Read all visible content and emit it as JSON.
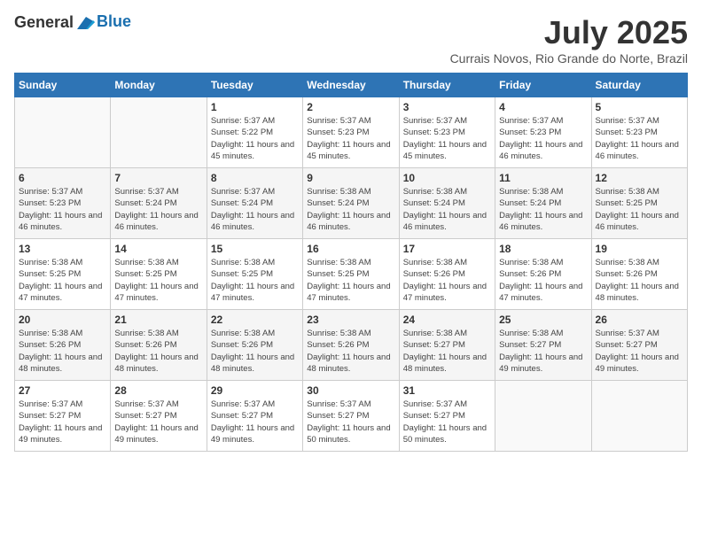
{
  "header": {
    "logo_line1": "General",
    "logo_line2": "Blue",
    "month_title": "July 2025",
    "location": "Currais Novos, Rio Grande do Norte, Brazil"
  },
  "days_of_week": [
    "Sunday",
    "Monday",
    "Tuesday",
    "Wednesday",
    "Thursday",
    "Friday",
    "Saturday"
  ],
  "weeks": [
    [
      {
        "day": "",
        "info": ""
      },
      {
        "day": "",
        "info": ""
      },
      {
        "day": "1",
        "info": "Sunrise: 5:37 AM\nSunset: 5:22 PM\nDaylight: 11 hours and 45 minutes."
      },
      {
        "day": "2",
        "info": "Sunrise: 5:37 AM\nSunset: 5:23 PM\nDaylight: 11 hours and 45 minutes."
      },
      {
        "day": "3",
        "info": "Sunrise: 5:37 AM\nSunset: 5:23 PM\nDaylight: 11 hours and 45 minutes."
      },
      {
        "day": "4",
        "info": "Sunrise: 5:37 AM\nSunset: 5:23 PM\nDaylight: 11 hours and 46 minutes."
      },
      {
        "day": "5",
        "info": "Sunrise: 5:37 AM\nSunset: 5:23 PM\nDaylight: 11 hours and 46 minutes."
      }
    ],
    [
      {
        "day": "6",
        "info": "Sunrise: 5:37 AM\nSunset: 5:23 PM\nDaylight: 11 hours and 46 minutes."
      },
      {
        "day": "7",
        "info": "Sunrise: 5:37 AM\nSunset: 5:24 PM\nDaylight: 11 hours and 46 minutes."
      },
      {
        "day": "8",
        "info": "Sunrise: 5:37 AM\nSunset: 5:24 PM\nDaylight: 11 hours and 46 minutes."
      },
      {
        "day": "9",
        "info": "Sunrise: 5:38 AM\nSunset: 5:24 PM\nDaylight: 11 hours and 46 minutes."
      },
      {
        "day": "10",
        "info": "Sunrise: 5:38 AM\nSunset: 5:24 PM\nDaylight: 11 hours and 46 minutes."
      },
      {
        "day": "11",
        "info": "Sunrise: 5:38 AM\nSunset: 5:24 PM\nDaylight: 11 hours and 46 minutes."
      },
      {
        "day": "12",
        "info": "Sunrise: 5:38 AM\nSunset: 5:25 PM\nDaylight: 11 hours and 46 minutes."
      }
    ],
    [
      {
        "day": "13",
        "info": "Sunrise: 5:38 AM\nSunset: 5:25 PM\nDaylight: 11 hours and 47 minutes."
      },
      {
        "day": "14",
        "info": "Sunrise: 5:38 AM\nSunset: 5:25 PM\nDaylight: 11 hours and 47 minutes."
      },
      {
        "day": "15",
        "info": "Sunrise: 5:38 AM\nSunset: 5:25 PM\nDaylight: 11 hours and 47 minutes."
      },
      {
        "day": "16",
        "info": "Sunrise: 5:38 AM\nSunset: 5:25 PM\nDaylight: 11 hours and 47 minutes."
      },
      {
        "day": "17",
        "info": "Sunrise: 5:38 AM\nSunset: 5:26 PM\nDaylight: 11 hours and 47 minutes."
      },
      {
        "day": "18",
        "info": "Sunrise: 5:38 AM\nSunset: 5:26 PM\nDaylight: 11 hours and 47 minutes."
      },
      {
        "day": "19",
        "info": "Sunrise: 5:38 AM\nSunset: 5:26 PM\nDaylight: 11 hours and 48 minutes."
      }
    ],
    [
      {
        "day": "20",
        "info": "Sunrise: 5:38 AM\nSunset: 5:26 PM\nDaylight: 11 hours and 48 minutes."
      },
      {
        "day": "21",
        "info": "Sunrise: 5:38 AM\nSunset: 5:26 PM\nDaylight: 11 hours and 48 minutes."
      },
      {
        "day": "22",
        "info": "Sunrise: 5:38 AM\nSunset: 5:26 PM\nDaylight: 11 hours and 48 minutes."
      },
      {
        "day": "23",
        "info": "Sunrise: 5:38 AM\nSunset: 5:26 PM\nDaylight: 11 hours and 48 minutes."
      },
      {
        "day": "24",
        "info": "Sunrise: 5:38 AM\nSunset: 5:27 PM\nDaylight: 11 hours and 48 minutes."
      },
      {
        "day": "25",
        "info": "Sunrise: 5:38 AM\nSunset: 5:27 PM\nDaylight: 11 hours and 49 minutes."
      },
      {
        "day": "26",
        "info": "Sunrise: 5:37 AM\nSunset: 5:27 PM\nDaylight: 11 hours and 49 minutes."
      }
    ],
    [
      {
        "day": "27",
        "info": "Sunrise: 5:37 AM\nSunset: 5:27 PM\nDaylight: 11 hours and 49 minutes."
      },
      {
        "day": "28",
        "info": "Sunrise: 5:37 AM\nSunset: 5:27 PM\nDaylight: 11 hours and 49 minutes."
      },
      {
        "day": "29",
        "info": "Sunrise: 5:37 AM\nSunset: 5:27 PM\nDaylight: 11 hours and 49 minutes."
      },
      {
        "day": "30",
        "info": "Sunrise: 5:37 AM\nSunset: 5:27 PM\nDaylight: 11 hours and 50 minutes."
      },
      {
        "day": "31",
        "info": "Sunrise: 5:37 AM\nSunset: 5:27 PM\nDaylight: 11 hours and 50 minutes."
      },
      {
        "day": "",
        "info": ""
      },
      {
        "day": "",
        "info": ""
      }
    ]
  ]
}
